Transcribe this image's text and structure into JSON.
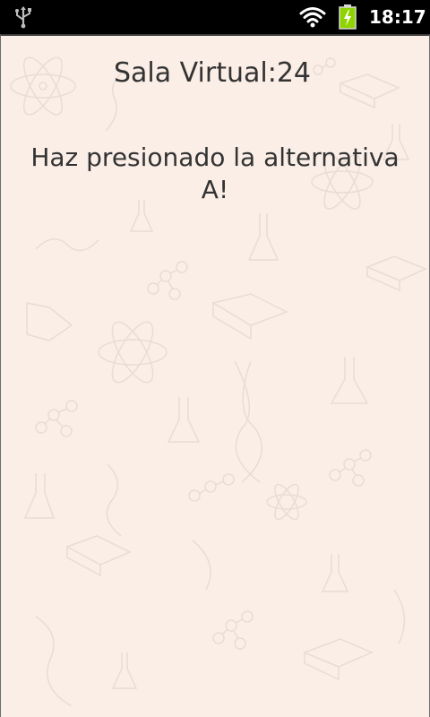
{
  "status_bar": {
    "time": "18:17",
    "icons": [
      "usb-icon",
      "wifi-icon",
      "battery-charging-icon"
    ],
    "battery_color": "#8fd400"
  },
  "screen": {
    "title": "Sala Virtual:24",
    "message": "Haz presionado la alternativa A!",
    "background_color": "#faeee7",
    "text_color": "#333333"
  }
}
